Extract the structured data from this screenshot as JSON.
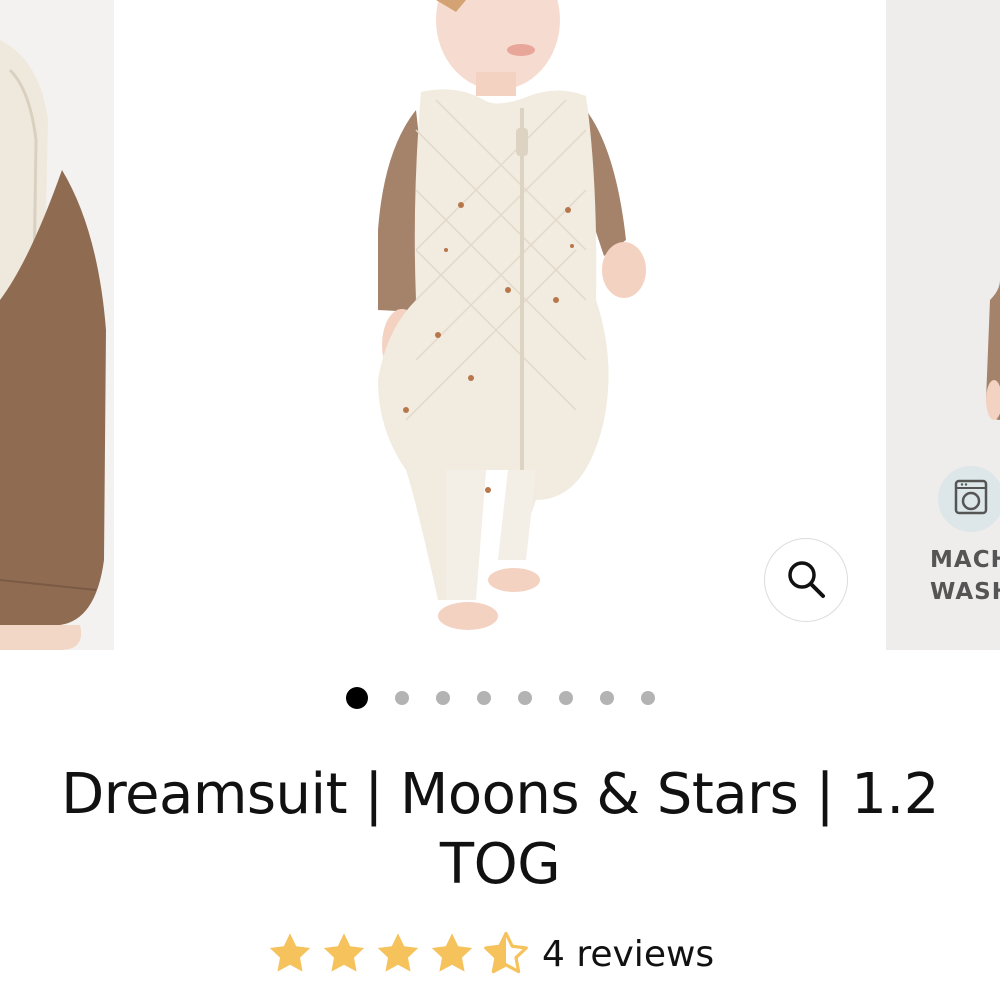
{
  "product": {
    "title": "Dreamsuit | Moons & Stars | 1.2 TOG",
    "rating_value": 4.5,
    "rating_max": 5,
    "reviews_label": "4 reviews"
  },
  "carousel": {
    "slide_count": 8,
    "active_index": 0,
    "next_slide_badge_text_line1": "MACH",
    "next_slide_badge_text_line2": "WASHA"
  },
  "colors": {
    "star": "#f5c25b",
    "dot_active": "#000000",
    "dot_inactive": "#b3b3b3",
    "garment": "#f1ebe0",
    "shirt": "#a5826a",
    "skin": "#f4d2c2"
  },
  "icons": {
    "zoom": "search-icon",
    "wash": "washing-machine-icon",
    "star": "star-icon"
  }
}
